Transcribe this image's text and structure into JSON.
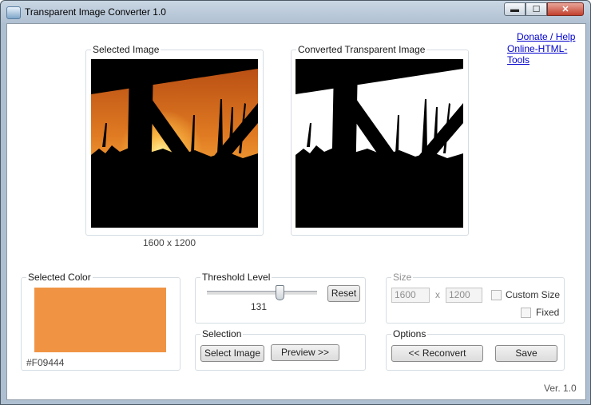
{
  "window": {
    "title": "Transparent Image Converter 1.0",
    "controls": {
      "minimize": "▬",
      "maximize": "☐",
      "close": "✕"
    }
  },
  "links": {
    "donate": "Donate / Help",
    "tools": "Online-HTML-Tools"
  },
  "selected_image": {
    "label": "Selected Image",
    "dimensions": "1600 x 1200"
  },
  "converted_image": {
    "label": "Converted Transparent Image"
  },
  "selected_color": {
    "label": "Selected Color",
    "hex": "#F09444",
    "swatch": "#F09444"
  },
  "threshold": {
    "label": "Threshold Level",
    "value": "131",
    "fraction": 0.66,
    "reset_label": "Reset"
  },
  "selection": {
    "label": "Selection",
    "select_button": "Select Image",
    "preview_button": "Preview >>"
  },
  "size": {
    "label": "Size",
    "width": "1600",
    "separator": "x",
    "height": "1200",
    "custom_size_label": "Custom Size",
    "fixed_label": "Fixed"
  },
  "options": {
    "label": "Options",
    "reconvert_button": "<< Reconvert",
    "save_button": "Save"
  },
  "version": "Ver. 1.0"
}
